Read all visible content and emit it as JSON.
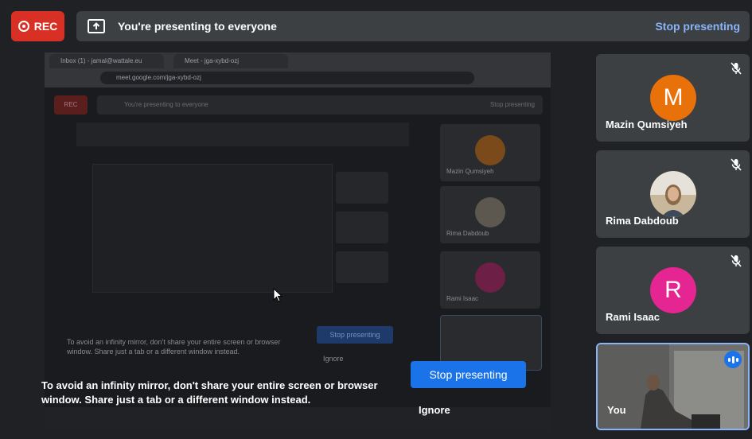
{
  "recording": {
    "label": "REC",
    "color": "#d93025"
  },
  "banner": {
    "message": "You're presenting to everyone",
    "stop_label": "Stop presenting",
    "icon": "present-to-all-icon"
  },
  "mirror": {
    "tabs": [
      "Inbox (1) - jamal@wattale.eu",
      "Meet - jga-xybd-ozj"
    ],
    "url": "meet.google.com/jga-xybd-ozj",
    "rec_label": "REC",
    "banner_message": "You're presenting to everyone",
    "banner_stop": "Stop presenting",
    "participants": [
      "Mazin Qumsiyeh",
      "Rima Dabdoub",
      "Rami Isaac"
    ],
    "hint": "To avoid an infinity mirror, don't share your entire screen or browser window. Share just a tab or a different window instead.",
    "stop_label": "Stop presenting",
    "ignore_label": "Ignore"
  },
  "overlay": {
    "hint": "To avoid an infinity mirror, don't share your entire screen or browser window. Share just a tab or a different window instead.",
    "stop_label": "Stop presenting",
    "ignore_label": "Ignore",
    "accent": "#1a73e8"
  },
  "participants": [
    {
      "name": "Mazin Qumsiyeh",
      "initial": "M",
      "color": "#e8710a",
      "muted": true
    },
    {
      "name": "Rima Dabdoub",
      "initial": "",
      "color": "#c9c3b8",
      "muted": true
    },
    {
      "name": "Rami Isaac",
      "initial": "R",
      "color": "#e52592",
      "muted": true
    },
    {
      "name": "You",
      "initial": "",
      "color": "#5a5d5e",
      "muted": false
    }
  ]
}
